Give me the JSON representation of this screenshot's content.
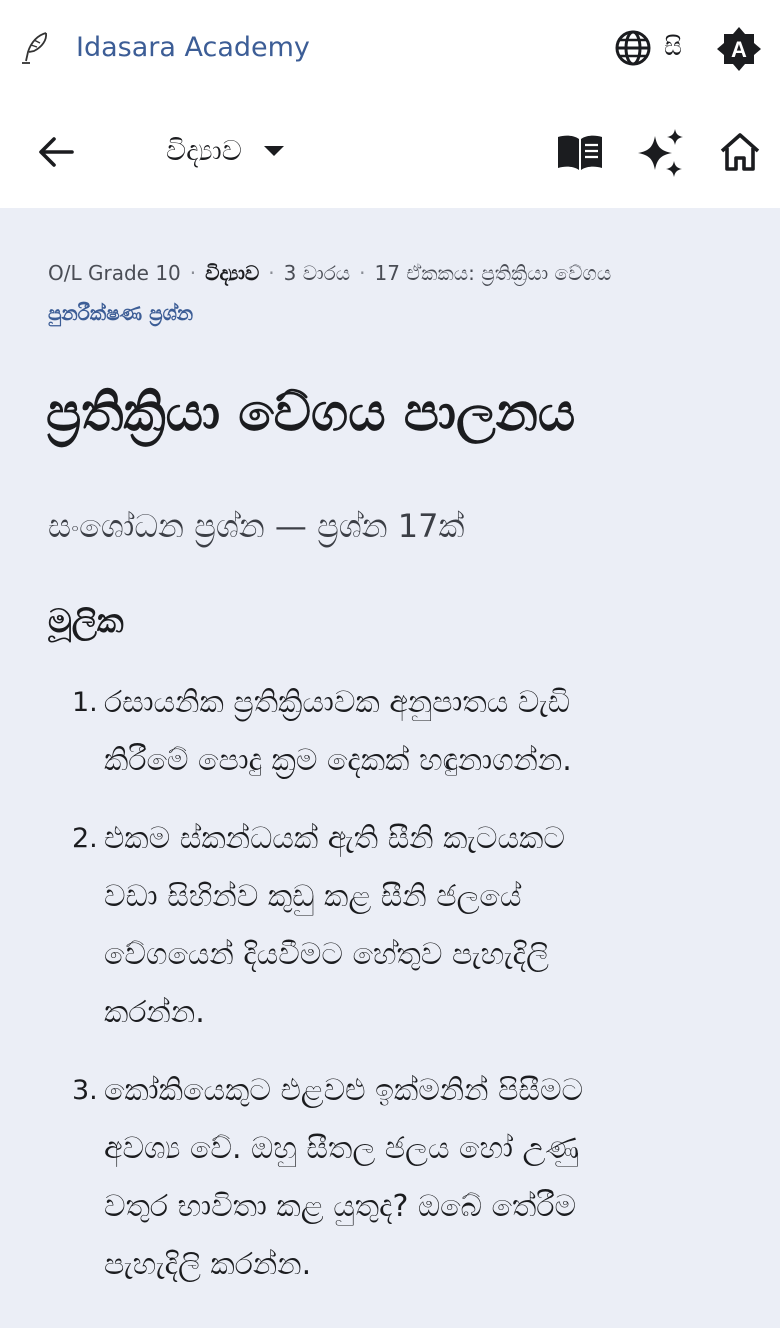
{
  "app": {
    "name": "Idasara Academy",
    "language_label": "සි",
    "theme_letter": "A"
  },
  "nav": {
    "subject": "විද්‍යාව"
  },
  "breadcrumb": {
    "items": [
      "O/L Grade 10",
      "විද්‍යාව",
      "3 වාරය",
      "17 ඒකකය: ප්‍රතික්‍රියා වේගය"
    ],
    "link": "පුනරීක්ෂණ ප්‍රශ්න"
  },
  "page": {
    "title": "ප්‍රතික්‍රියා වේගය පාලනය",
    "subtitle": "සංශෝධන ප්‍රශ්න — ප්‍රශ්න 17ක්",
    "section": "මූලික"
  },
  "questions": [
    {
      "num": "1.",
      "lines": [
        "රසායනික ප්‍රතික්‍රියාවක අනුපාතය වැඩි",
        "කිරීමේ පොදු ක්‍රම දෙකක් හඳුනාගන්න."
      ]
    },
    {
      "num": "2.",
      "lines": [
        "එකම ස්කන්ධයක් ඇති සීනි කැටයකට",
        "වඩා සිහින්ව කුඩු කළ සීනි ජලයේ",
        "වේගයෙන් දියවීමට හේතුව පැහැදිලි",
        "කරන්න."
      ]
    },
    {
      "num": "3.",
      "lines": [
        "කෝකියෙකුට එළවළු ඉක්මනින් පිසීමට",
        "අවශ්‍ය වේ. ඔහු සීතල ජලය හෝ උණු",
        "වතුර භාවිතා කළ යුතුද? ඔබේ තේරීම",
        "පැහැදිලි කරන්න."
      ]
    }
  ],
  "icons": {
    "brand": "quill-pen-icon",
    "language": "globe-icon",
    "theme": "auto-theme-icon",
    "back": "arrow-left-icon",
    "caret": "caret-down-icon",
    "book": "open-book-icon",
    "ai": "sparkles-icon",
    "home": "home-icon"
  },
  "colors": {
    "brand": "#3c5d96",
    "background": "#ebeef6",
    "surface": "#ffffff",
    "text": "#1b1c1f"
  }
}
